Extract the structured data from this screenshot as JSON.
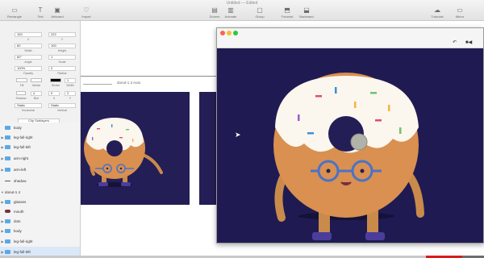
{
  "window": {
    "title": "Untitled — Edited"
  },
  "toolbar": {
    "items": [
      {
        "label": "Rectangle",
        "icon": "rectangle-icon"
      },
      {
        "label": "Text",
        "icon": "text-icon"
      },
      {
        "label": "Artboard",
        "icon": "artboard-icon"
      },
      {
        "label": "Import",
        "icon": "import-icon"
      },
      {
        "label": "Drivers",
        "icon": "drivers-icon"
      },
      {
        "label": "Animate",
        "icon": "animate-icon"
      },
      {
        "label": "Group",
        "icon": "group-icon"
      },
      {
        "label": "Forward",
        "icon": "forward-icon"
      },
      {
        "label": "Backward",
        "icon": "backward-icon"
      },
      {
        "label": "Tutorials",
        "icon": "tutorials-icon"
      },
      {
        "label": "Mirror",
        "icon": "mirror-icon"
      }
    ]
  },
  "inspector": {
    "x": "153",
    "y": "222",
    "x_label": "X",
    "y_label": "Y",
    "width": "60",
    "height": "100",
    "width_label": "Width",
    "height_label": "Height",
    "angle": "60°",
    "scale": "1",
    "angle_label": "Angle",
    "scale_label": "Scale",
    "opacity": "100%",
    "radius": "0",
    "opacity_label": "Opacity",
    "radius_label": "Radius",
    "fill_label": "Fill",
    "media_label": "Media",
    "stroke_label": "Stroke",
    "stroke_width": "1",
    "stroke_width_label": "Width",
    "shadow_label": "Shadow",
    "blur_label": "Blur",
    "x2_label": "X",
    "y2_label": "Y",
    "blur_value": "4",
    "x2_value": "0",
    "y2_value": "2",
    "h_option": "Static",
    "v_option": "Static",
    "h_label": "Horizontal",
    "v_label": "Vertical",
    "clip_button": "Clip Sublayers",
    "colors": {
      "fill": "#ffffff",
      "stroke": "#000000",
      "shadow_swatch": "#000000"
    }
  },
  "layers": [
    {
      "name": "body",
      "icon": "folder",
      "expandable": false
    },
    {
      "name": "leg-full-right",
      "icon": "folder",
      "expandable": true
    },
    {
      "name": "leg-full-left",
      "icon": "folder",
      "expandable": true
    },
    {
      "name": "arm-right",
      "icon": "folder",
      "expandable": true
    },
    {
      "name": "arm-left",
      "icon": "folder",
      "expandable": true
    },
    {
      "name": "shadow",
      "icon": "shape",
      "expandable": false
    },
    {
      "name": "donut-1 4",
      "icon": "none",
      "expandable": true,
      "expanded": true
    },
    {
      "name": "glasses",
      "icon": "folder",
      "expandable": true
    },
    {
      "name": "mouth",
      "icon": "mouth",
      "expandable": false
    },
    {
      "name": "dots",
      "icon": "folder",
      "expandable": true
    },
    {
      "name": "body",
      "icon": "folder",
      "expandable": true
    },
    {
      "name": "leg-full-right",
      "icon": "folder",
      "expandable": true
    },
    {
      "name": "leg-full-left",
      "icon": "folder",
      "expandable": true
    }
  ],
  "canvas": {
    "connection_label": "donut-1 3 Auto",
    "artboard_color": "#231e55"
  },
  "preview": {
    "background": "#1f1b52",
    "undo_icon": "undo-icon",
    "camera_icon": "camera-icon"
  },
  "video": {
    "progress": 0.88,
    "highlight_start": 0.88,
    "highlight_end": 0.955
  }
}
